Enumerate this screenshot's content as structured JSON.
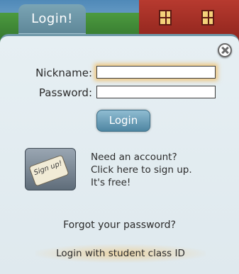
{
  "tab": {
    "label": "Login!"
  },
  "form": {
    "nickname_label": "Nickname:",
    "nickname_value": "",
    "password_label": "Password:",
    "password_value": "",
    "login_button": "Login"
  },
  "signup": {
    "image_text": "Sign up!",
    "lines": [
      "Need an account?",
      "Click here to sign up.",
      "It's free!"
    ]
  },
  "links": {
    "forgot_password": "Forgot your password?",
    "student_login": "Login with student class ID"
  },
  "colors": {
    "tab": "#6f98a8",
    "button": "#5e90aa",
    "focus_glow": "#f4b13e",
    "panel": "#e3ecf0"
  }
}
